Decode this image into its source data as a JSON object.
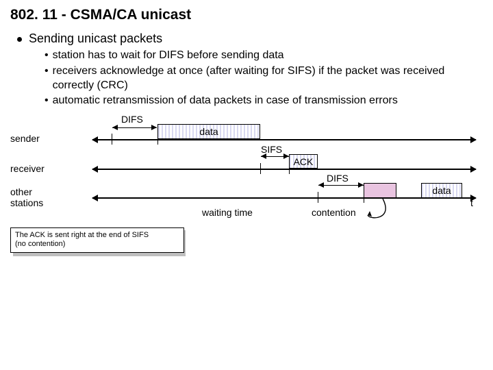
{
  "title": "802. 11 - CSMA/CA unicast",
  "heading": "Sending unicast packets",
  "bullets": [
    "station has to wait for DIFS before sending data",
    "receivers acknowledge at once (after waiting for SIFS) if the packet was received correctly (CRC)",
    "automatic retransmission of data packets in case of transmission errors"
  ],
  "lanes": {
    "sender": "sender",
    "receiver": "receiver",
    "other": "other\nstations"
  },
  "labels": {
    "difs1": "DIFS",
    "data1": "data",
    "sifs": "SIFS",
    "ack": "ACK",
    "difs2": "DIFS",
    "data2": "data",
    "waiting": "waiting time",
    "contention": "contention",
    "t": "t"
  },
  "note": "The ACK is sent right at the end of SIFS\n(no contention)"
}
